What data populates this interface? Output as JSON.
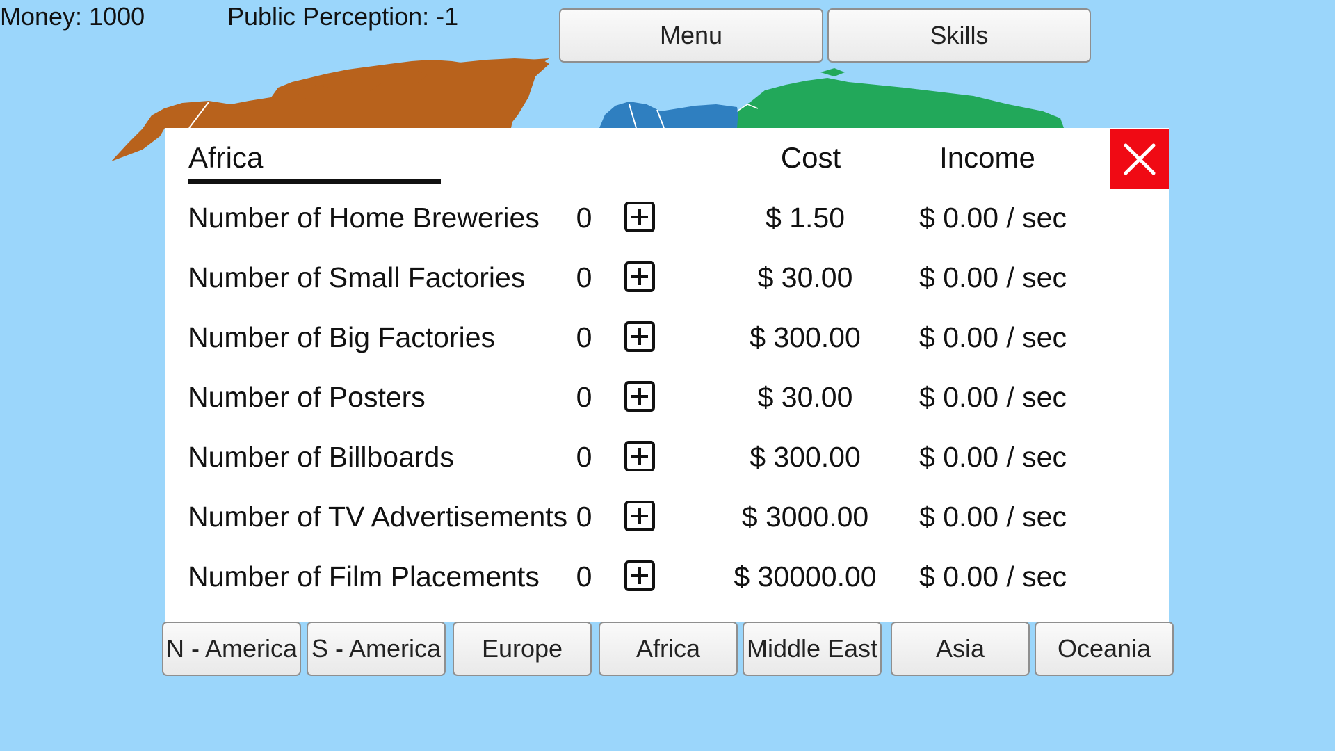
{
  "hud": {
    "money": "Money: 1000",
    "public_perception": "Public Perception: -1",
    "menu_label": "Menu",
    "skills_label": "Skills"
  },
  "panel": {
    "region_title": "Africa",
    "cost_header": "Cost",
    "income_header": "Income",
    "rows": [
      {
        "label": "Number of Home Breweries",
        "count": "0",
        "cost": "$ 1.50",
        "income": "$ 0.00 / sec"
      },
      {
        "label": "Number of Small Factories",
        "count": "0",
        "cost": "$ 30.00",
        "income": "$ 0.00 / sec"
      },
      {
        "label": "Number of Big Factories",
        "count": "0",
        "cost": "$ 300.00",
        "income": "$ 0.00 / sec"
      },
      {
        "label": "Number of Posters",
        "count": "0",
        "cost": "$ 30.00",
        "income": "$ 0.00 / sec"
      },
      {
        "label": "Number of Billboards",
        "count": "0",
        "cost": "$ 300.00",
        "income": "$ 0.00 / sec"
      },
      {
        "label": "Number of TV Advertisements",
        "count": "0",
        "cost": "$ 3000.00",
        "income": "$ 0.00 / sec"
      },
      {
        "label": "Number of Film Placements",
        "count": "0",
        "cost": "$ 30000.00",
        "income": "$ 0.00 / sec"
      }
    ]
  },
  "region_tabs": [
    "N - America",
    "S - America",
    "Europe",
    "Africa",
    "Middle East",
    "Asia",
    "Oceania"
  ],
  "icons": {
    "close": "close-icon",
    "add": "plus-icon"
  },
  "colors": {
    "background": "#9bd6fb",
    "close_button": "#f00a14",
    "north_america": "#b8621c",
    "europe": "#2f7fc0",
    "asia": "#22a85a"
  }
}
